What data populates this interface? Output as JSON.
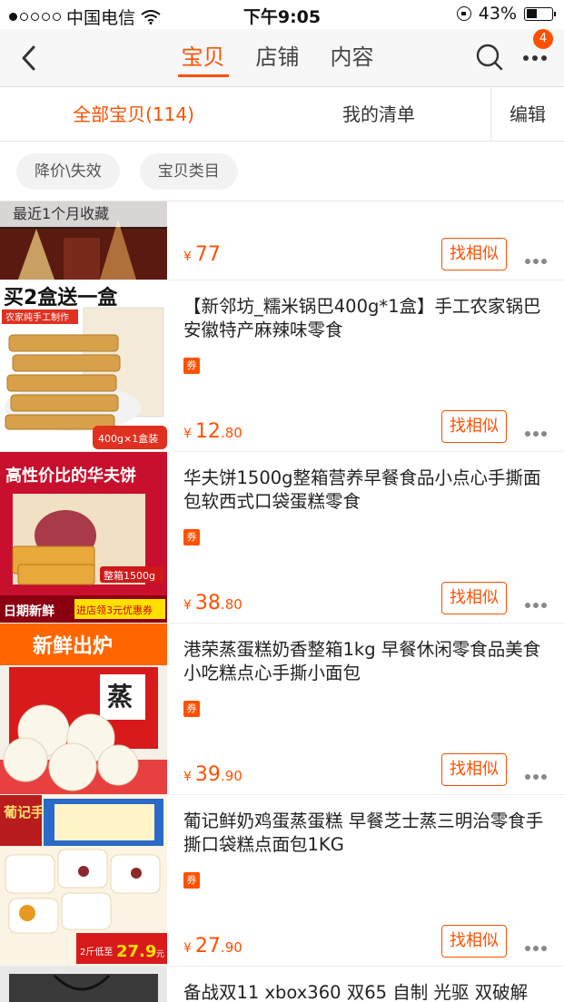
{
  "status_bar": {
    "carrier": "中国电信",
    "time": "下午9:05",
    "battery_percent": "43%",
    "battery_level": 0.43
  },
  "nav": {
    "tabs": [
      "宝贝",
      "店铺",
      "内容"
    ],
    "active_tab": "宝贝",
    "badge_count": "4",
    "icons": [
      "back-icon",
      "search-icon",
      "more-icon"
    ]
  },
  "filter_tabs": {
    "all": "全部宝贝(114)",
    "list": "我的清单",
    "edit": "编辑"
  },
  "chips": [
    "降价\\失效",
    "宝贝类目"
  ],
  "recent_label": "最近1个月收藏",
  "coupon_label": "券",
  "similar_label": "找相似",
  "products": [
    {
      "title": "",
      "price_int": "77",
      "price_dec": "",
      "coupon": false
    },
    {
      "title": "【新邻坊_糯米锅巴400g*1盒】手工农家锅巴安徽特产麻辣味零食",
      "price_int": "12",
      "price_dec": ".80",
      "coupon": true,
      "image_text": {
        "top": "买2盒送一盒",
        "sub": "农家纯手工制作",
        "tag": "400g×1盒装"
      }
    },
    {
      "title": "华夫饼1500g整箱营养早餐食品小点心手撕面包软西式口袋蛋糕零食",
      "price_int": "38",
      "price_dec": ".80",
      "coupon": true,
      "image_text": {
        "top": "高性价比的华夫饼",
        "tag": "整箱1500g",
        "bottom_left": "日期新鲜",
        "bottom_right": "进店领3元优惠券"
      }
    },
    {
      "title": "港荣蒸蛋糕奶香整箱1kg 早餐休闲零食品美食小吃糕点心手撕小面包",
      "price_int": "39",
      "price_dec": ".90",
      "coupon": true,
      "image_text": {
        "top": "新鲜出炉",
        "box": "蒸"
      }
    },
    {
      "title": "葡记鲜奶鸡蛋蒸蛋糕 早餐芝士蒸三明治零食手撕口袋糕点面包1KG",
      "price_int": "27",
      "price_dec": ".90",
      "coupon": true,
      "image_text": {
        "brand": "葡记手信",
        "tag_small": "2斤低至",
        "tag_price": "27.9",
        "tag_unit": "元"
      }
    },
    {
      "title": "备战双11 xbox360 双65 自制 光驱 双破解",
      "price_int": "",
      "price_dec": "",
      "coupon": false
    }
  ]
}
